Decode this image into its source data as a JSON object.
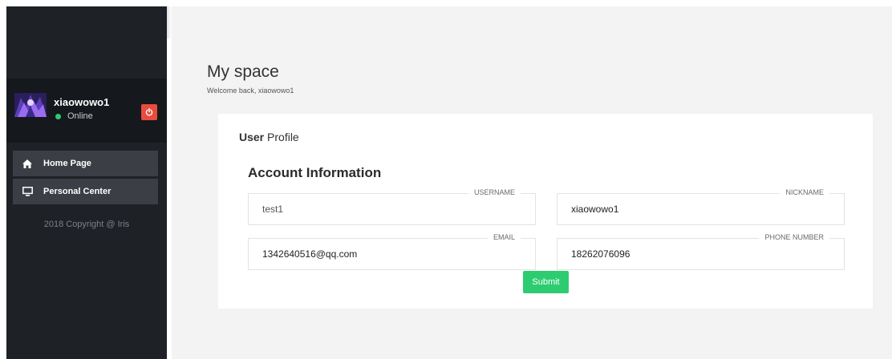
{
  "sidebar": {
    "user": {
      "name": "xiaowowo1",
      "status": "Online"
    },
    "menu": [
      {
        "label": "Home Page",
        "icon": "home-icon"
      },
      {
        "label": "Personal Center",
        "icon": "monitor-icon"
      }
    ],
    "copyright": "2018 Copyright @ Iris"
  },
  "page": {
    "title": "My space",
    "subtitle": "Welcome back, xiaowowo1"
  },
  "card": {
    "title_bold": "User",
    "title_rest": " Profile",
    "section_title": "Account Information",
    "fields": {
      "username": {
        "label": "USERNAME",
        "value": "test1"
      },
      "nickname": {
        "label": "NICKNAME",
        "value": "xiaowowo1"
      },
      "email": {
        "label": "EMAIL",
        "value": "1342640516@qq.com"
      },
      "phone": {
        "label": "PHONE NUMBER",
        "value": "18262076096"
      }
    },
    "submit_label": "Submit"
  },
  "colors": {
    "sidebar_bg": "#1e2227",
    "user_panel_bg": "#15181c",
    "menu_item_bg": "#3b3f45",
    "online": "#2ecc71",
    "power": "#e74c3c",
    "submit": "#2ecc71",
    "main_bg": "#f3f3f3"
  }
}
